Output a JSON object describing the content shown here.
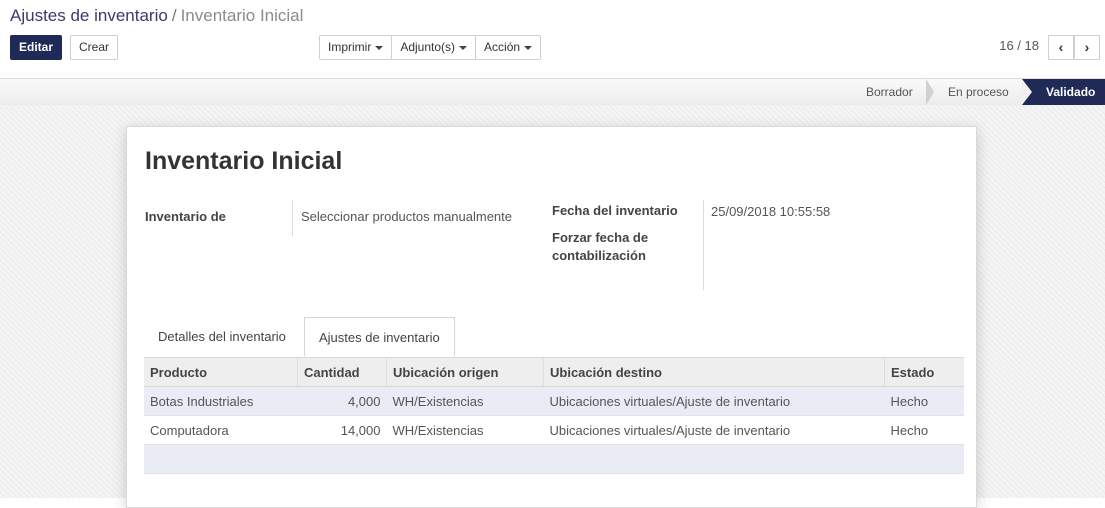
{
  "breadcrumb": {
    "parent": "Ajustes de inventario",
    "separator": "/",
    "current": "Inventario Inicial"
  },
  "toolbar": {
    "edit_label": "Editar",
    "create_label": "Crear",
    "print_label": "Imprimir",
    "attachments_label": "Adjunto(s)",
    "action_label": "Acción"
  },
  "pager": {
    "value": "16 / 18",
    "prev_icon": "‹",
    "next_icon": "›"
  },
  "statusbar": {
    "stages": [
      "Borrador",
      "En proceso",
      "Validado"
    ],
    "active": "Validado"
  },
  "form": {
    "title": "Inventario Inicial",
    "inventory_of_label": "Inventario de",
    "inventory_of_value": "Seleccionar productos manualmente",
    "date_label": "Fecha del inventario",
    "date_value": "25/09/2018 10:55:58",
    "force_date_label": "Forzar fecha de contabilización"
  },
  "tabs": [
    "Detalles del inventario",
    "Ajustes de inventario"
  ],
  "active_tab": "Ajustes de inventario",
  "table": {
    "columns": [
      "Producto",
      "Cantidad",
      "Ubicación origen",
      "Ubicación destino",
      "Estado"
    ],
    "rows": [
      [
        "Botas Industriales",
        "4,000",
        "WH/Existencias",
        "Ubicaciones virtuales/Ajuste de inventario",
        "Hecho"
      ],
      [
        "Computadora",
        "14,000",
        "WH/Existencias",
        "Ubicaciones virtuales/Ajuste de inventario",
        "Hecho"
      ]
    ]
  },
  "colors": {
    "primary": "#1f2a57",
    "row_highlight": "#e9ecf5"
  }
}
